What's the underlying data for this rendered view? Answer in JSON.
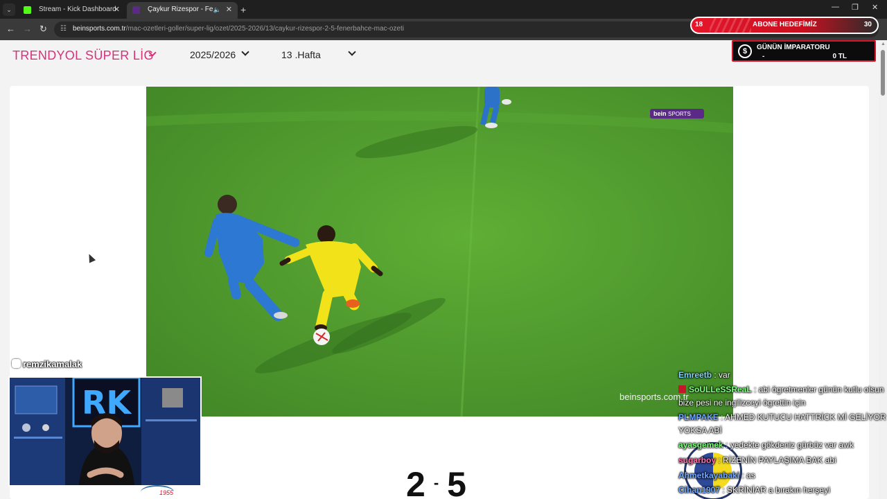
{
  "browser": {
    "tabs": [
      {
        "title": "Stream - Kick Dashboard",
        "favicon_color": "#53fc18"
      },
      {
        "title": "Çaykur Rizespor - Fenerbahçe",
        "favicon_color": "#5b2a86",
        "active": true
      }
    ],
    "url": {
      "domain": "beinsports.com.tr",
      "path": "/mac-ozetleri-goller/super-lig/ozet/2025-2026/13/caykur-rizespor-2-5-fenerbahce-mac-ozeti"
    }
  },
  "overlay": {
    "sub_goal": {
      "current": "18",
      "label": "ABONE HEDEFİMİZ",
      "target": "30"
    },
    "emperor": {
      "title": "GÜNÜN İMPARATORU",
      "name": "-",
      "amount": "0 TL"
    },
    "instagram": "remzikamalak"
  },
  "page": {
    "league": "TRENDYOL SÜPER LİG",
    "season": "2025/2026",
    "week": "13 .Hafta",
    "video": {
      "logo": "bein",
      "logo_suffix": "SPORTS",
      "watermark": "beinsports.com.tr"
    },
    "score": {
      "home": "2",
      "away": "5"
    },
    "crest_year": "1955"
  },
  "chat": [
    {
      "user": "Emreetb",
      "color": "#7fd4ff",
      "text": ": var",
      "badge": false
    },
    {
      "user": "SoULLeSSReaL",
      "color": "#7fff7f",
      "text": ": abi ögretmenler günün kutlu olsun bize pesi ne ingilizceyi ögrettin için",
      "badge": true
    },
    {
      "user": "PLMPAKE",
      "color": "#6fa8ff",
      "text": ": AHMED KUTUCU HATTRİCK Mİ GELİYOR YOKSA ABİ",
      "badge": false
    },
    {
      "user": "ayasgemek",
      "color": "#7fff7f",
      "text": ": yedekte gökdeniz gürbüz var awk",
      "badge": false
    },
    {
      "user": "sugarboy",
      "color": "#ff6fa8",
      "text": ": RİZENİN PAYLAŞIMA BAK abi",
      "badge": false
    },
    {
      "user": "Ahmetkayabaki",
      "color": "#6fa8ff",
      "text": ": as",
      "badge": false
    },
    {
      "user": "Cihan1907",
      "color": "#6fa8ff",
      "text": ": SKRİNİAR a bırakın herşeyi",
      "badge": false
    }
  ],
  "colors": {
    "accent": "#d9307a",
    "goal_red": "#e6162b",
    "pitch": "#4f9a2c"
  },
  "icons": [
    "back-icon",
    "forward-icon",
    "reload-icon",
    "site-info-icon",
    "close-icon",
    "audio-icon",
    "new-tab-icon",
    "chevron-down-icon",
    "coin-icon",
    "instagram-icon"
  ]
}
